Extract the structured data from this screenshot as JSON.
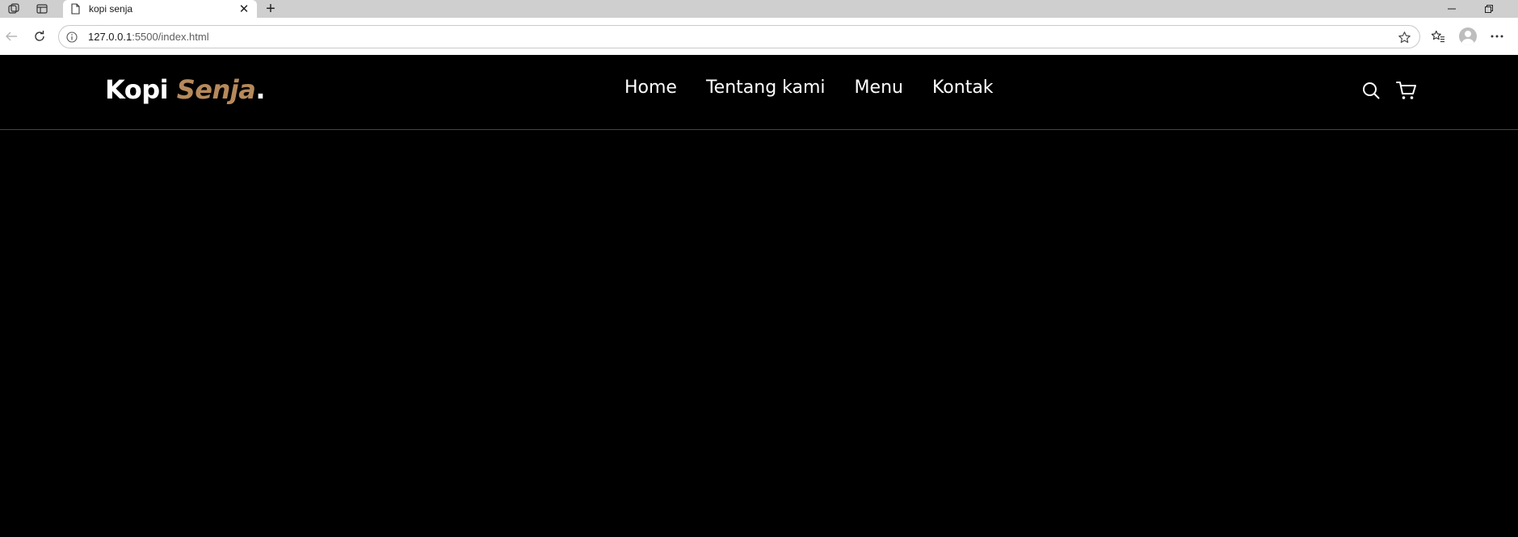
{
  "browser": {
    "tab": {
      "title": "kopi senja"
    },
    "address": {
      "host": "127.0.0.1",
      "rest": ":5500/index.html"
    }
  },
  "site": {
    "logo": {
      "main": "Kopi ",
      "accent": "Senja",
      "dot": "."
    },
    "nav": [
      {
        "label": "Home"
      },
      {
        "label": "Tentang kami"
      },
      {
        "label": "Menu"
      },
      {
        "label": "Kontak"
      }
    ],
    "colors": {
      "accent": "#b6895b",
      "background": "#000000",
      "divider": "#5b3f28"
    }
  }
}
